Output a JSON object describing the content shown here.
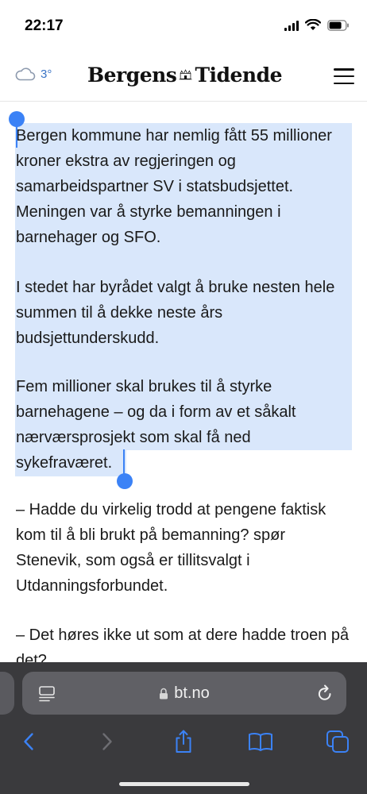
{
  "status_bar": {
    "time": "22:17"
  },
  "header": {
    "weather_temp": "3°",
    "logo_left": "Bergens",
    "logo_right": "Tidende"
  },
  "article": {
    "paragraphs": [
      "Bergen kommune har nemlig fått 55 millioner kroner ekstra av regjeringen og samarbeidspartner SV i statsbudsjettet. Meningen var å styrke bemanningen i barnehager og SFO.",
      "I stedet har byrådet valgt å bruke nesten hele summen til å dekke neste års budsjettunderskudd.",
      "Fem millioner skal brukes til å styrke barnehagene – og da i form av et såkalt nærværsprosjekt som skal få ned sykefraværet.",
      "– Hadde du virkelig trodd at pengene faktisk kom til å bli brukt på bemanning? spør Stenevik, som også er tillitsvalgt i Utdanningsforbundet.",
      "– Det høres ikke ut som at dere hadde troen på det?"
    ]
  },
  "browser": {
    "url": "bt.no"
  },
  "colors": {
    "selection": "#d9e7fb",
    "handle": "#3b82f6",
    "toolbar": "#3a3a3d",
    "nav_icon": "#3b82f6"
  }
}
